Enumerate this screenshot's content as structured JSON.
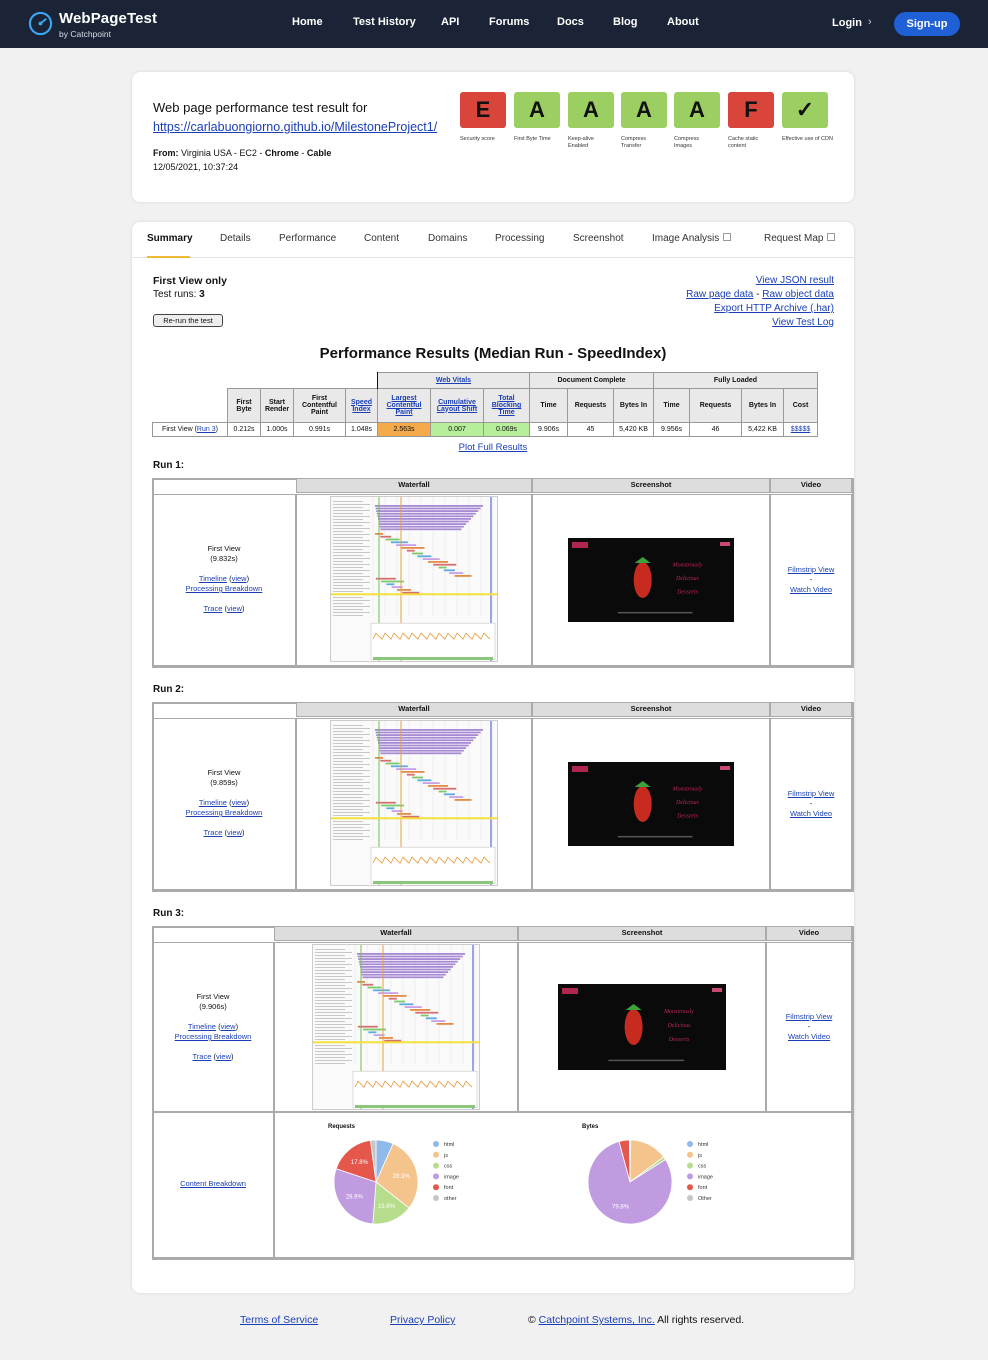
{
  "header": {
    "brand": "WebPageTest",
    "brand_sub": "by Catchpoint",
    "nav": [
      "Home",
      "Test History",
      "API",
      "Forums",
      "Docs",
      "Blog",
      "About"
    ],
    "login": "Login",
    "signup": "Sign-up"
  },
  "result": {
    "title": "Web page performance test result for",
    "url": "https://carlabuongiorno.github.io/MilestoneProject1/",
    "from_label": "From:",
    "from_location": "Virginia USA - EC2 -",
    "browser": "Chrome",
    "connection": "Cable",
    "date": "12/05/2021, 10:37:24",
    "grades": [
      {
        "grade": "E",
        "label": "Security score",
        "color": "#d9443b"
      },
      {
        "grade": "A",
        "label": "First Byte Time",
        "color": "#9ccf62"
      },
      {
        "grade": "A",
        "label": "Keep-alive Enabled",
        "color": "#9ccf62"
      },
      {
        "grade": "A",
        "label": "Compress Transfer",
        "color": "#9ccf62"
      },
      {
        "grade": "A",
        "label": "Compress Images",
        "color": "#9ccf62"
      },
      {
        "grade": "F",
        "label": "Cache static content",
        "color": "#d9443b"
      },
      {
        "grade": "✓",
        "label": "Effective use of CDN",
        "color": "#9ccf62"
      }
    ]
  },
  "tabs": [
    "Summary",
    "Details",
    "Performance",
    "Content",
    "Domains",
    "Processing",
    "Screenshot",
    "Image Analysis",
    "Request Map"
  ],
  "summary": {
    "first_view_only": "First View only",
    "test_runs_label": "Test runs:",
    "test_runs": "3",
    "rerun": "Re-run the test",
    "links": {
      "json": "View JSON result",
      "raw_page": "Raw page data",
      "sep": "-",
      "raw_object": "Raw object data",
      "har": "Export HTTP Archive (.har)",
      "log": "View Test Log"
    },
    "perf_title": "Performance Results (Median Run - SpeedIndex)",
    "perf_table": {
      "groups": [
        "Web Vitals",
        "Document Complete",
        "Fully Loaded"
      ],
      "headers": [
        "First Byte",
        "Start Render",
        "First Contentful Paint",
        "Speed Index",
        "Largest Contentful Paint",
        "Cumulative Layout Shift",
        "Total Blocking Time",
        "Time",
        "Requests",
        "Bytes In",
        "Time",
        "Requests",
        "Bytes In",
        "Cost"
      ],
      "row_label": "First View (",
      "row_link": "Run 3",
      "row_label_end": ")",
      "values": [
        "0.212s",
        "1.000s",
        "0.991s",
        "1.048s",
        "2.563s",
        "0.007",
        "0.069s",
        "9.906s",
        "45",
        "5,420 KB",
        "9.956s",
        "46",
        "5,422 KB",
        "$$$$$"
      ]
    },
    "plot_full": "Plot Full Results"
  },
  "runs": [
    {
      "label": "Run 1:",
      "view": "First View",
      "time": "(9.832s)"
    },
    {
      "label": "Run 2:",
      "view": "First View",
      "time": "(9.859s)"
    },
    {
      "label": "Run 3:",
      "view": "First View",
      "time": "(9.906s)"
    }
  ],
  "run_table": {
    "col_waterfall": "Waterfall",
    "col_screenshot": "Screenshot",
    "col_video": "Video",
    "timeline": "Timeline",
    "view": "view",
    "processing": "Processing Breakdown",
    "trace": "Trace",
    "filmstrip": "Filmstrip View",
    "dash": "-",
    "watch": "Watch Video",
    "content_breakdown": "Content Breakdown"
  },
  "screenshot_text": {
    "heading_line1": "Monstrously",
    "heading_line2": "Delicious",
    "heading_line3": "Desserts"
  },
  "colors": {
    "html": "#8eb9e8",
    "js": "#f5c48d",
    "css": "#b5dd8c",
    "image": "#c09be0",
    "font": "#e5574a",
    "other": "#c6c6c6"
  },
  "chart_data": [
    {
      "type": "pie",
      "title": "Requests",
      "categories": [
        "html",
        "js",
        "css",
        "image",
        "font",
        "other"
      ],
      "values": [
        6.7,
        28.9,
        15.6,
        28.9,
        17.8,
        2.1
      ],
      "labels": [
        "",
        "28.9%",
        "15.6%",
        "28.9%",
        "17.8%",
        ""
      ]
    },
    {
      "type": "pie",
      "title": "Bytes",
      "categories": [
        "html",
        "js",
        "css",
        "image",
        "font",
        "Other"
      ],
      "values": [
        0.3,
        14.5,
        1.2,
        79.8,
        4.0,
        0.2
      ],
      "labels": [
        "",
        "",
        "",
        "79.8%",
        "",
        ""
      ]
    }
  ],
  "footer": {
    "terms": "Terms of Service",
    "privacy": "Privacy Policy",
    "copyright": "©",
    "company": "Catchpoint Systems, Inc.",
    "rights": "All rights reserved."
  }
}
